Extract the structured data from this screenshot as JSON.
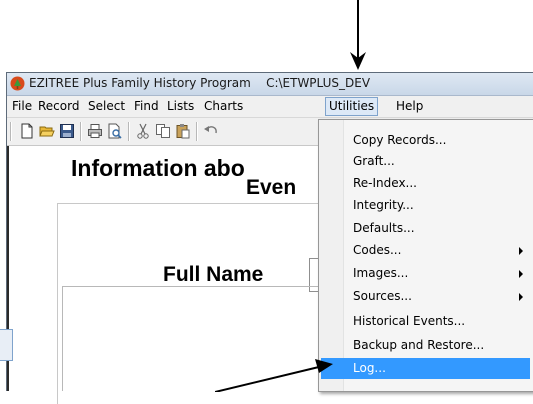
{
  "window": {
    "title": "EZITREE Plus Family History Program",
    "path": "C:\\ETWPLUS_DEV"
  },
  "menubar": {
    "items": [
      {
        "label": "File"
      },
      {
        "label": "Record"
      },
      {
        "label": "Select"
      },
      {
        "label": "Find"
      },
      {
        "label": "Lists"
      },
      {
        "label": "Charts"
      },
      {
        "label": "Utilities"
      },
      {
        "label": "Help"
      }
    ]
  },
  "toolbar": {
    "icons": [
      "new-document-icon",
      "open-folder-icon",
      "save-icon",
      "print-icon",
      "print-preview-icon",
      "cut-icon",
      "copy-icon",
      "paste-icon",
      "undo-icon"
    ]
  },
  "content": {
    "info_heading": "Information abo",
    "events_heading": "Even",
    "full_name_label": "Full Name"
  },
  "utilities_menu": {
    "items": [
      {
        "label": "Copy Records...",
        "has_submenu": false
      },
      {
        "label": "Graft...",
        "has_submenu": false
      },
      {
        "label": "Re-Index...",
        "has_submenu": false
      },
      {
        "label": "Integrity...",
        "has_submenu": false
      },
      {
        "label": "Defaults...",
        "has_submenu": false
      },
      {
        "label": "Codes...",
        "has_submenu": true
      },
      {
        "label": "Images...",
        "has_submenu": true
      },
      {
        "label": "Sources...",
        "has_submenu": true
      },
      {
        "label": "Historical Events...",
        "has_submenu": false
      },
      {
        "label": "Backup and Restore...",
        "has_submenu": false
      },
      {
        "label": "Log...",
        "has_submenu": false,
        "highlighted": true
      }
    ]
  },
  "colors": {
    "highlight": "#3399ff",
    "menu_active": "#dde9f7"
  }
}
